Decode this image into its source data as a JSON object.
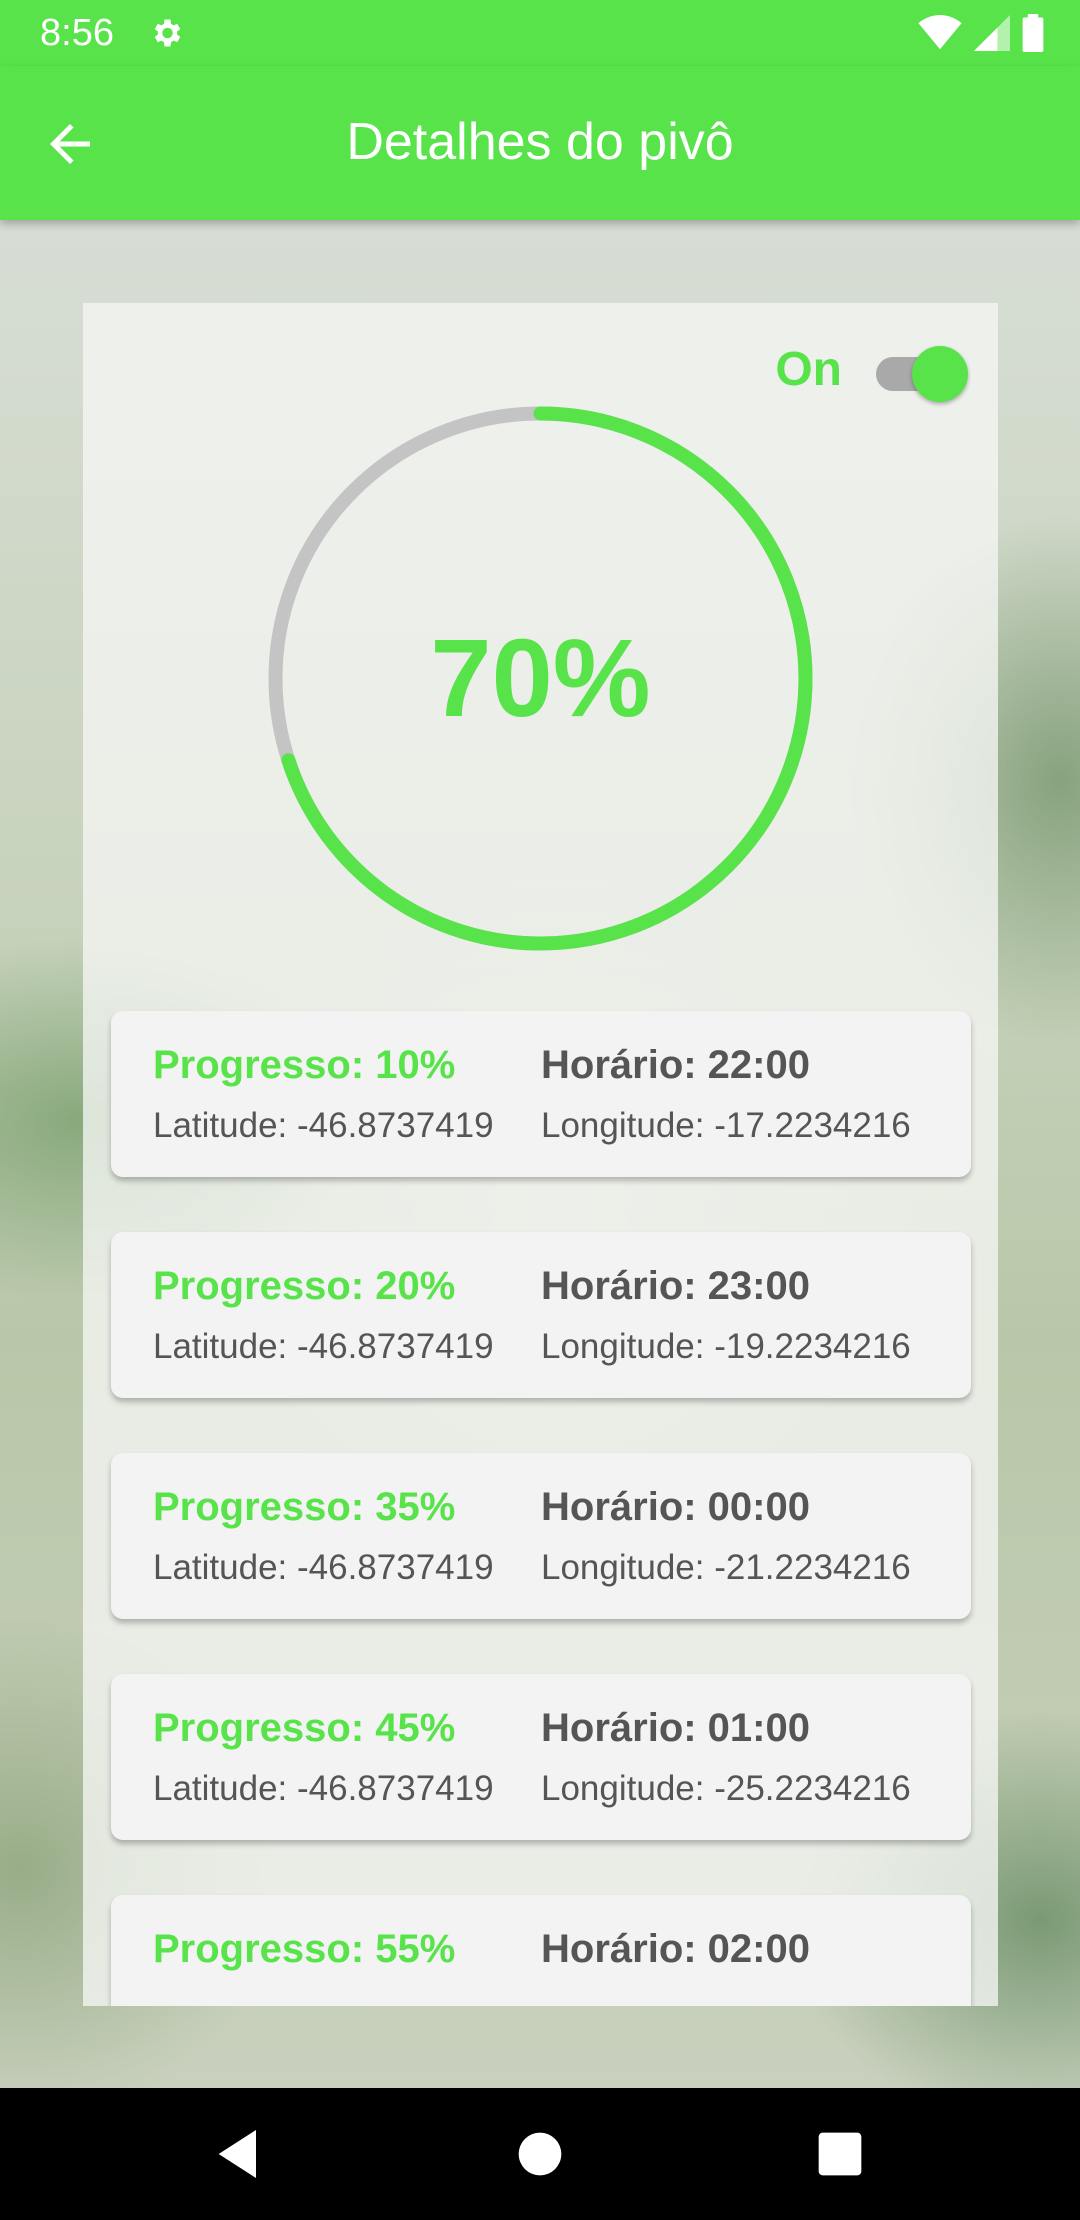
{
  "status_bar": {
    "time": "8:56",
    "icons": [
      "settings-icon",
      "wifi-icon",
      "signal-icon",
      "battery-icon"
    ]
  },
  "app_bar": {
    "title": "Detalhes do pivô",
    "back_icon": "arrow-back-icon"
  },
  "panel": {
    "toggle_label": "On",
    "toggle_on": true,
    "progress_text": "70%",
    "progress_value": 0.7
  },
  "items": [
    {
      "progress": "Progresso: 10%",
      "time": "Horário: 22:00",
      "latitude": "Latitude: -46.8737419",
      "longitude": "Longitude: -17.2234216"
    },
    {
      "progress": "Progresso: 20%",
      "time": "Horário: 23:00",
      "latitude": "Latitude: -46.8737419",
      "longitude": "Longitude: -19.2234216"
    },
    {
      "progress": "Progresso: 35%",
      "time": "Horário: 00:00",
      "latitude": "Latitude: -46.8737419",
      "longitude": "Longitude: -21.2234216"
    },
    {
      "progress": "Progresso: 45%",
      "time": "Horário: 01:00",
      "latitude": "Latitude: -46.8737419",
      "longitude": "Longitude: -25.2234216"
    },
    {
      "progress": "Progresso: 55%",
      "time": "Horário: 02:00",
      "latitude": "",
      "longitude": ""
    }
  ],
  "nav_bar": {
    "icons": [
      "back-triangle-icon",
      "home-circle-icon",
      "recents-square-icon"
    ]
  },
  "colors": {
    "accent": "#58e34b",
    "ring_track": "#c4c4c4",
    "text_dark": "#555555"
  }
}
